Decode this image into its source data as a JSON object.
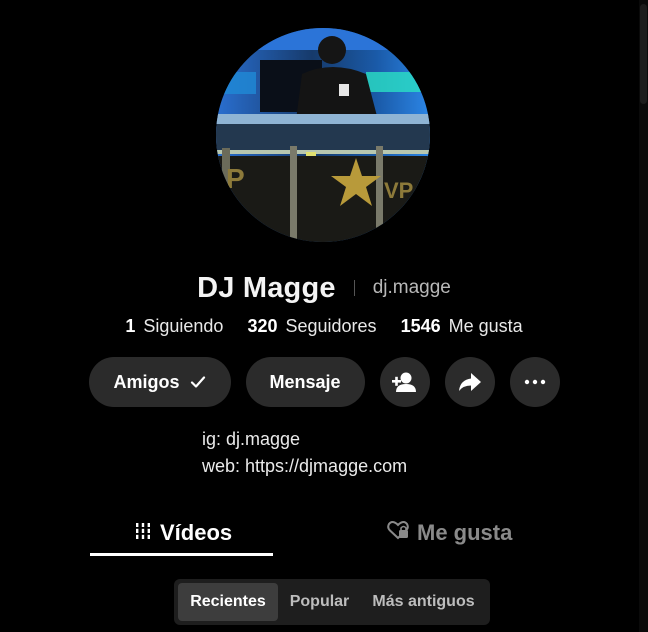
{
  "profile": {
    "display_name": "DJ Magge",
    "username": "dj.magge"
  },
  "stats": [
    {
      "count": "1",
      "label": "Siguiendo"
    },
    {
      "count": "320",
      "label": "Seguidores"
    },
    {
      "count": "1546",
      "label": "Me gusta"
    }
  ],
  "actions": {
    "friends_label": "Amigos",
    "message_label": "Mensaje",
    "icons": [
      "check-icon",
      "add-friend-icon",
      "share-icon",
      "more-icon"
    ]
  },
  "bio": {
    "line1": "ig: dj.magge",
    "line2": "web: https://djmagge.com"
  },
  "tabs": {
    "videos_label": "Vídeos",
    "likes_label": "Me gusta",
    "active": "videos"
  },
  "sort": {
    "options": [
      "Recientes",
      "Popular",
      "Más antiguos"
    ],
    "selected": "Recientes"
  },
  "colors": {
    "background": "#000000",
    "button": "#2b2b2b",
    "inactive_tab": "#8a8a8a"
  }
}
